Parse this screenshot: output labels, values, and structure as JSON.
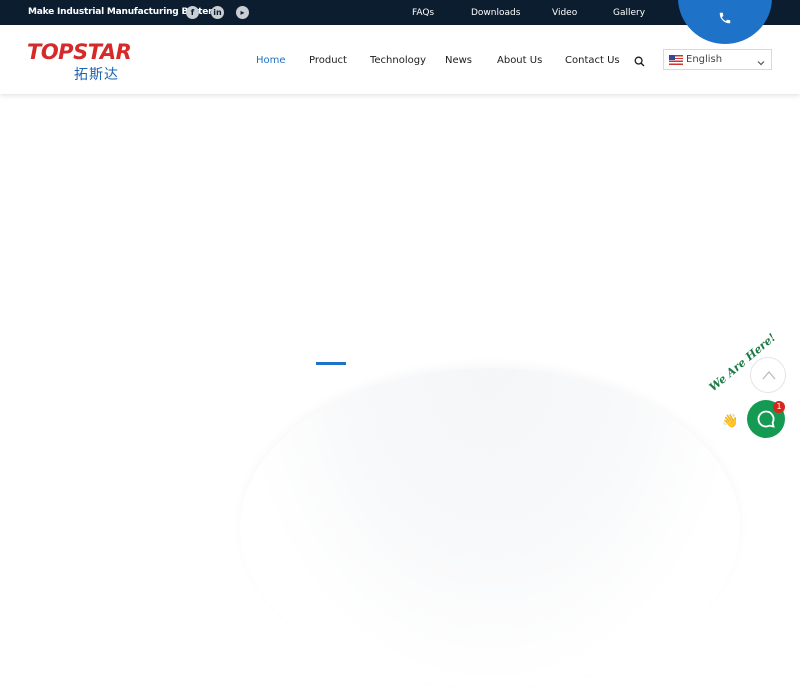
{
  "topbar": {
    "tagline": "Make Industrial Manufacturing Better",
    "social": [
      {
        "icon": "facebook-icon",
        "glyph": "f"
      },
      {
        "icon": "linkedin-icon",
        "glyph": "in"
      },
      {
        "icon": "youtube-icon",
        "glyph": "▸"
      }
    ],
    "links": [
      "FAQs",
      "Downloads",
      "Video",
      "Gallery"
    ]
  },
  "header": {
    "logo": {
      "text_en": "TOPSTAR",
      "text_cn": "拓斯达"
    },
    "nav": [
      {
        "label": "Home",
        "active": true
      },
      {
        "label": "Product",
        "active": false
      },
      {
        "label": "Technology",
        "active": false
      },
      {
        "label": "News",
        "active": false
      },
      {
        "label": "About Us",
        "active": false
      },
      {
        "label": "Contact Us",
        "active": false
      }
    ],
    "language": {
      "selected": "English",
      "flag": "us-flag-icon"
    }
  },
  "widgets": {
    "chat_label": "We Are Here!",
    "chat_badge": "1",
    "wave_emoji": "👋"
  },
  "colors": {
    "topbar_bg": "#0b1d2f",
    "accent": "#1e73c8",
    "logo_red": "#d5292a",
    "chat_green": "#159a54",
    "badge_red": "#d9261c"
  }
}
